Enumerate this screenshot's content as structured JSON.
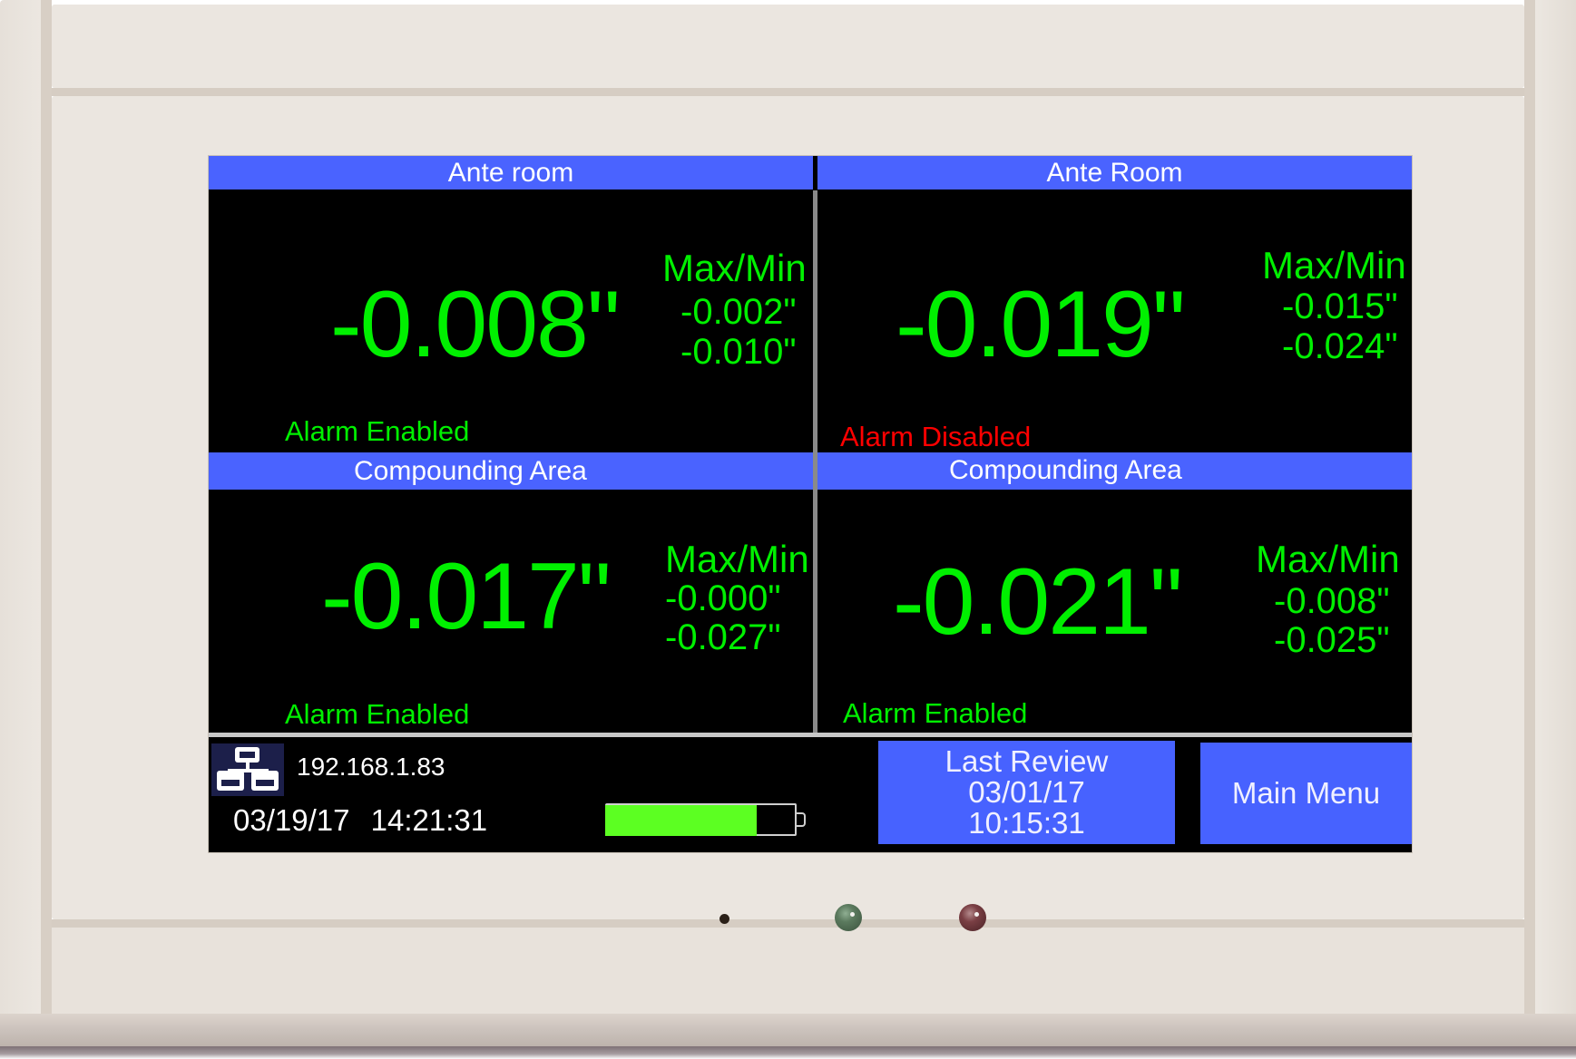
{
  "device": {
    "leds": [
      {
        "name": "sensor",
        "color": "#2b2018"
      },
      {
        "name": "green",
        "color": "#5b7a5e"
      },
      {
        "name": "red",
        "color": "#7a3f44"
      }
    ]
  },
  "colors": {
    "header_blue": "#4a63ff",
    "reading_green": "#00f000",
    "alarm_disabled_red": "#ff0000",
    "battery_green": "#5cff22"
  },
  "zones": [
    {
      "title": "Ante room",
      "value": "-0.008\"",
      "maxmin_label": "Max/Min",
      "max": "-0.002\"",
      "min": "-0.010\"",
      "alarm": "Alarm Enabled",
      "alarm_state": "enabled"
    },
    {
      "title": "Ante Room",
      "value": "-0.019\"",
      "maxmin_label": "Max/Min",
      "max": "-0.015\"",
      "min": "-0.024\"",
      "alarm": "Alarm Disabled",
      "alarm_state": "disabled"
    },
    {
      "title": "Compounding Area",
      "value": "-0.017\"",
      "maxmin_label": "Max/Min",
      "max": "-0.000\"",
      "min": "-0.027\"",
      "alarm": "Alarm Enabled",
      "alarm_state": "enabled"
    },
    {
      "title": "Compounding Area",
      "value": "-0.021\"",
      "maxmin_label": "Max/Min",
      "max": "-0.008\"",
      "min": "-0.025\"",
      "alarm": "Alarm Enabled",
      "alarm_state": "enabled"
    }
  ],
  "status": {
    "network_icon": "network-icon",
    "ip_address": "192.168.1.83",
    "date": "03/19/17",
    "time": "14:21:31",
    "battery_icon": "battery-icon",
    "battery_level_percent": 79
  },
  "buttons": {
    "last_review": {
      "label": "Last Review",
      "date": "03/01/17",
      "time": "10:15:31"
    },
    "main_menu": {
      "label": "Main Menu"
    }
  }
}
